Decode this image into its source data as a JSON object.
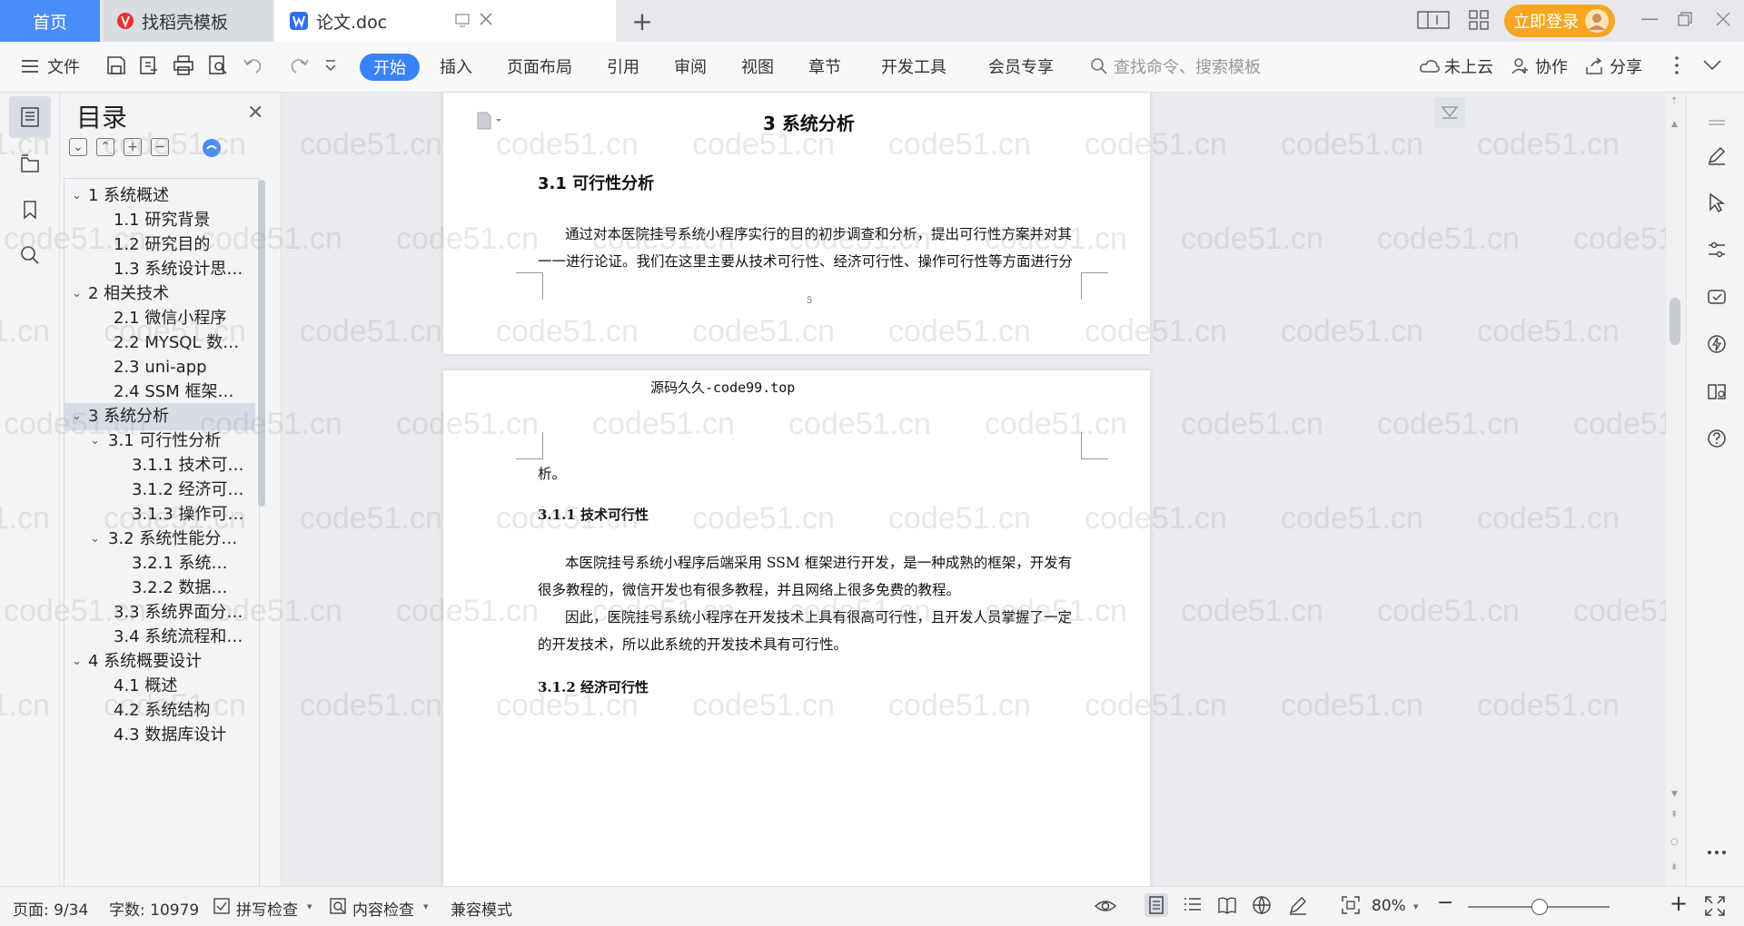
{
  "tabs": {
    "home": "首页",
    "daoke": "找稻壳模板",
    "doc": "论文.doc",
    "login": "立即登录"
  },
  "ribbon": {
    "file": "文件",
    "start": "开始",
    "insert": "插入",
    "layout": "页面布局",
    "reference": "引用",
    "review": "审阅",
    "view": "视图",
    "chapter": "章节",
    "devtools": "开发工具",
    "member": "会员专享",
    "search_placeholder": "查找命令、搜索模板",
    "cloud": "未上云",
    "collab": "协作",
    "share": "分享"
  },
  "toc": {
    "title": "目录",
    "items": [
      "1 系统概述",
      "1.1  研究背景",
      "1.2 研究目的",
      "1.3 系统设计思…",
      "2 相关技术",
      "2.1 微信小程序",
      "2.2 MYSQL 数…",
      "2.3 uni-app",
      "2.4 SSM 框架…",
      "3 系统分析",
      "3.1 可行性分析",
      "3.1.1 技术可…",
      "3.1.2 经济可…",
      "3.1.3 操作可…",
      "3.2 系统性能分…",
      "3.2.1  系统…",
      "3.2.2  数据…",
      "3.3 系统界面分…",
      "3.4 系统流程和…",
      "4 系统概要设计",
      "4.1 概述",
      "4.2 系统结构",
      "4.3 数据库设计"
    ]
  },
  "page1": {
    "chapter_title": "3 系统分析",
    "section_title": "3.1 可行性分析",
    "para1_line1": "通过对本医院挂号系统小程序实行的目的初步调查和分析，提出可行性方案并对其",
    "para1_line2": "一一进行论证。我们在这里主要从技术可行性、经济可行性、操作可行性等方面进行分",
    "page_number": "5"
  },
  "page2": {
    "header": "源码久久-code99.top",
    "cont": "析。",
    "sub1": "3.1.1 技术可行性",
    "p1_l1": "本医院挂号系统小程序后端采用 SSM 框架进行开发，是一种成熟的框架，开发有",
    "p1_l2": "很多教程的，微信开发也有很多教程，并且网络上很多免费的教程。",
    "p2_l1": "因此，医院挂号系统小程序在开发技术上具有很高可行性，且开发人员掌握了一定",
    "p2_l2": "的开发技术，所以此系统的开发技术具有可行性。",
    "sub2": "3.1.2 经济可行性"
  },
  "watermark": "code51.cn",
  "status": {
    "page": "页面: 9/34",
    "words": "字数: 10979",
    "spell": "拼写检查",
    "content": "内容检查",
    "compat": "兼容模式",
    "zoom": "80%"
  }
}
